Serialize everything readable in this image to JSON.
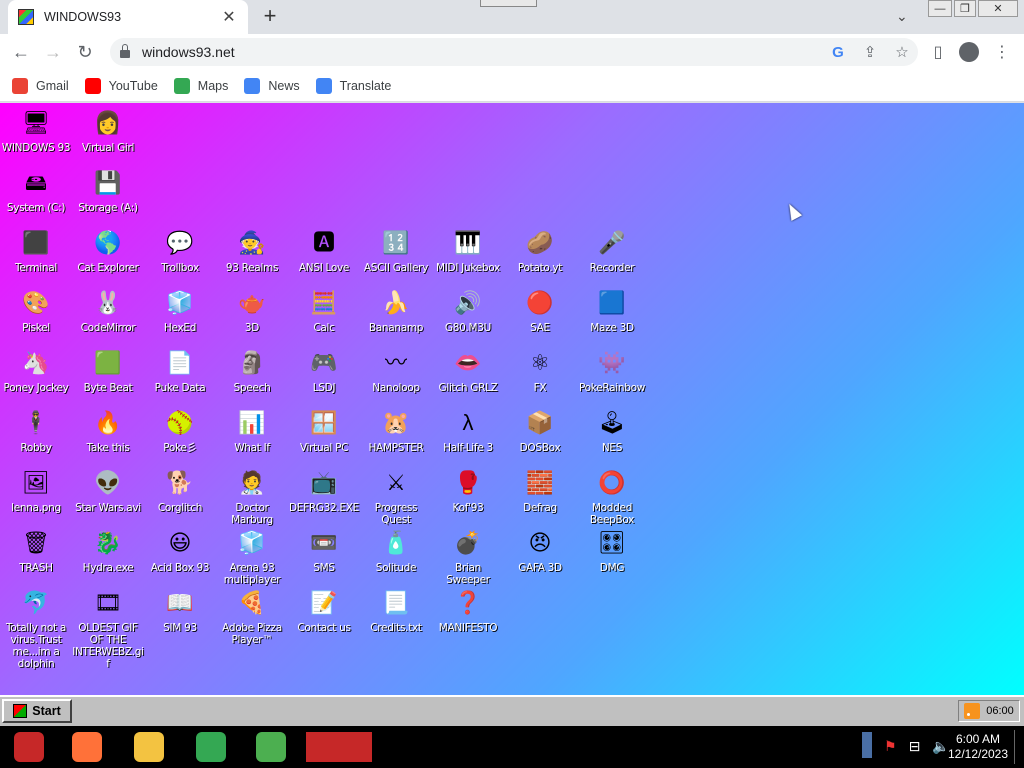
{
  "browser": {
    "tab_title": "WINDOWS93",
    "tab_close": "✕",
    "new_tab": "+",
    "url": "windows93.net",
    "bookmarks": [
      {
        "label": "Gmail",
        "color": "#ea4335"
      },
      {
        "label": "YouTube",
        "color": "#ff0000"
      },
      {
        "label": "Maps",
        "color": "#34a853"
      },
      {
        "label": "News",
        "color": "#4285f4"
      },
      {
        "label": "Translate",
        "color": "#4285f4"
      }
    ]
  },
  "desktop": {
    "icons": [
      {
        "label": "WINDOWS 93",
        "glyph": "🖥",
        "col": 0,
        "row": 0
      },
      {
        "label": "Virtual Girl",
        "glyph": "👩",
        "col": 1,
        "row": 0
      },
      {
        "label": "System (C:)",
        "glyph": "🖴",
        "col": 0,
        "row": 1
      },
      {
        "label": "Storage (A:)",
        "glyph": "💾",
        "col": 1,
        "row": 1
      },
      {
        "label": "Terminal",
        "glyph": "⬛",
        "col": 0,
        "row": 2
      },
      {
        "label": "Cat Explorer",
        "glyph": "🌎",
        "col": 1,
        "row": 2
      },
      {
        "label": "Trollbox",
        "glyph": "💬",
        "col": 2,
        "row": 2
      },
      {
        "label": "93 Realms",
        "glyph": "🧙",
        "col": 3,
        "row": 2
      },
      {
        "label": "ANSI Love",
        "glyph": "🅰",
        "col": 4,
        "row": 2
      },
      {
        "label": "ASCII Gallery",
        "glyph": "🔢",
        "col": 5,
        "row": 2
      },
      {
        "label": "MIDI Jukebox",
        "glyph": "🎹",
        "col": 6,
        "row": 2
      },
      {
        "label": "Potato.yt",
        "glyph": "🥔",
        "col": 7,
        "row": 2
      },
      {
        "label": "Recorder",
        "glyph": "🎤",
        "col": 8,
        "row": 2
      },
      {
        "label": "Piskel",
        "glyph": "🎨",
        "col": 0,
        "row": 3
      },
      {
        "label": "CodeMirror",
        "glyph": "🐰",
        "col": 1,
        "row": 3
      },
      {
        "label": "HexEd",
        "glyph": "🧊",
        "col": 2,
        "row": 3
      },
      {
        "label": "3D",
        "glyph": "🫖",
        "col": 3,
        "row": 3
      },
      {
        "label": "Calc",
        "glyph": "🧮",
        "col": 4,
        "row": 3
      },
      {
        "label": "Bananamp",
        "glyph": "🍌",
        "col": 5,
        "row": 3
      },
      {
        "label": "G80.M3U",
        "glyph": "🔊",
        "col": 6,
        "row": 3
      },
      {
        "label": "SAE",
        "glyph": "🔴",
        "col": 7,
        "row": 3
      },
      {
        "label": "Maze 3D",
        "glyph": "🟦",
        "col": 8,
        "row": 3
      },
      {
        "label": "Poney Jockey",
        "glyph": "🦄",
        "col": 0,
        "row": 4
      },
      {
        "label": "Byte Beat",
        "glyph": "🟩",
        "col": 1,
        "row": 4
      },
      {
        "label": "Puke Data",
        "glyph": "📄",
        "col": 2,
        "row": 4
      },
      {
        "label": "Speech",
        "glyph": "🗿",
        "col": 3,
        "row": 4
      },
      {
        "label": "LSDJ",
        "glyph": "🎮",
        "col": 4,
        "row": 4
      },
      {
        "label": "Nanoloop",
        "glyph": "〰",
        "col": 5,
        "row": 4
      },
      {
        "label": "Glitch GRLZ",
        "glyph": "👄",
        "col": 6,
        "row": 4
      },
      {
        "label": "FX",
        "glyph": "⚛",
        "col": 7,
        "row": 4
      },
      {
        "label": "PokeRainbow",
        "glyph": "👾",
        "col": 8,
        "row": 4
      },
      {
        "label": "Robby",
        "glyph": "🕴",
        "col": 0,
        "row": 5
      },
      {
        "label": "Take this",
        "glyph": "🔥",
        "col": 1,
        "row": 5
      },
      {
        "label": "Poke彡",
        "glyph": "🥎",
        "col": 2,
        "row": 5
      },
      {
        "label": "What If",
        "glyph": "📊",
        "col": 3,
        "row": 5
      },
      {
        "label": "Virtual PC",
        "glyph": "🪟",
        "col": 4,
        "row": 5
      },
      {
        "label": "HAMPSTER",
        "glyph": "🐹",
        "col": 5,
        "row": 5
      },
      {
        "label": "Half-Life 3",
        "glyph": "λ",
        "col": 6,
        "row": 5
      },
      {
        "label": "DOSBox",
        "glyph": "📦",
        "col": 7,
        "row": 5
      },
      {
        "label": "NES",
        "glyph": "🕹",
        "col": 8,
        "row": 5
      },
      {
        "label": "lenna.png",
        "glyph": "🖼",
        "col": 0,
        "row": 6
      },
      {
        "label": "Star Wars.avi",
        "glyph": "👽",
        "col": 1,
        "row": 6
      },
      {
        "label": "Corglitch",
        "glyph": "🐕",
        "col": 2,
        "row": 6
      },
      {
        "label": "Doctor Marburg",
        "glyph": "🧑‍⚕",
        "col": 3,
        "row": 6
      },
      {
        "label": "DEFRG32.EXE",
        "glyph": "📺",
        "col": 4,
        "row": 6
      },
      {
        "label": "Progress Quest",
        "glyph": "⚔",
        "col": 5,
        "row": 6
      },
      {
        "label": "Kof'93",
        "glyph": "🥊",
        "col": 6,
        "row": 6
      },
      {
        "label": "Defrag",
        "glyph": "🧱",
        "col": 7,
        "row": 6
      },
      {
        "label": "Modded BeepBox",
        "glyph": "⭕",
        "col": 8,
        "row": 6
      },
      {
        "label": "TRASH",
        "glyph": "🗑",
        "col": 0,
        "row": 7
      },
      {
        "label": "Hydra.exe",
        "glyph": "🐉",
        "col": 1,
        "row": 7
      },
      {
        "label": "Acid Box 93",
        "glyph": "😃",
        "col": 2,
        "row": 7
      },
      {
        "label": "Arena 93 multiplayer",
        "glyph": "🧊",
        "col": 3,
        "row": 7
      },
      {
        "label": "SMS",
        "glyph": "📼",
        "col": 4,
        "row": 7
      },
      {
        "label": "Solitude",
        "glyph": "🧴",
        "col": 5,
        "row": 7
      },
      {
        "label": "Brian Sweeper",
        "glyph": "💣",
        "col": 6,
        "row": 7
      },
      {
        "label": "GAFA 3D",
        "glyph": "😠",
        "col": 7,
        "row": 7
      },
      {
        "label": "DMG",
        "glyph": "🎛",
        "col": 8,
        "row": 7
      },
      {
        "label": "Totally not a virus.Trust me...im a dolphin",
        "glyph": "🐬",
        "col": 0,
        "row": 8
      },
      {
        "label": "OLDEST GIF OF THE INTERWEBZ.gif",
        "glyph": "🎞",
        "col": 1,
        "row": 8
      },
      {
        "label": "SIM 93",
        "glyph": "📖",
        "col": 2,
        "row": 8
      },
      {
        "label": "Adobe Pizza Player™",
        "glyph": "🍕",
        "col": 3,
        "row": 8
      },
      {
        "label": "Contact us",
        "glyph": "📝",
        "col": 4,
        "row": 8
      },
      {
        "label": "Credits.txt",
        "glyph": "📃",
        "col": 5,
        "row": 8
      },
      {
        "label": "MANIFESTO",
        "glyph": "❓",
        "col": 6,
        "row": 8
      }
    ]
  },
  "w93_taskbar": {
    "start_label": "Start",
    "clock": "06:00"
  },
  "os_taskbar": {
    "apps": [
      {
        "name": "santa-app-icon",
        "color": "#c62828"
      },
      {
        "name": "firefox-icon",
        "color": "#ff7139"
      },
      {
        "name": "file-explorer-icon",
        "color": "#f3c341"
      },
      {
        "name": "chrome-icon",
        "color": "#34a853"
      },
      {
        "name": "pc-app-icon",
        "color": "#4caf50"
      },
      {
        "name": "red-app-icon",
        "color": "#c62828"
      }
    ],
    "time": "6:00 AM",
    "date": "12/12/2023"
  }
}
